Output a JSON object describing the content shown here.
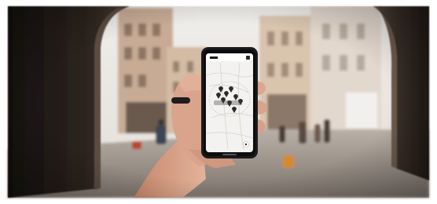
{
  "scene": {
    "description_icons": [
      "hand-holding-phone",
      "map-pin-icon"
    ],
    "colors": {
      "sky": "#e9e6e2",
      "arch_dark": "#2a221d",
      "street": "#9e958d",
      "building_warm": "#c9a98e",
      "building_light": "#ddd3ca",
      "phone_body": "#1b1b1d",
      "screen_map": "#f1efed",
      "skin": "#d8a38a"
    }
  },
  "phone_screen": {
    "map_pins": 9,
    "top_bar_label": ""
  }
}
